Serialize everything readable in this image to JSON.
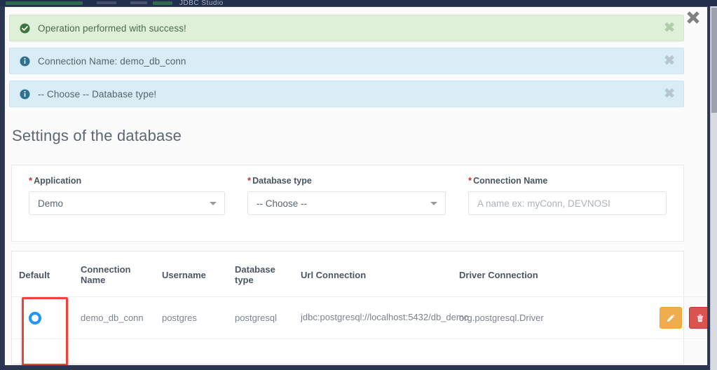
{
  "background_strip": {
    "title_fragment": "JDBC Studio"
  },
  "modal": {
    "close_label": "✖",
    "close_icon": "close-x-icon"
  },
  "alerts": [
    {
      "type": "success",
      "icon": "check-circle-icon",
      "message": "Operation performed with success!",
      "close_label": "✖"
    },
    {
      "type": "info",
      "icon": "info-circle-icon",
      "message": "Connection Name: demo_db_conn",
      "close_label": "✖"
    },
    {
      "type": "info",
      "icon": "info-circle-icon",
      "message": "-- Choose -- Database type!",
      "close_label": "✖"
    }
  ],
  "section": {
    "heading": "Settings of the database"
  },
  "form": {
    "required_marker": "*",
    "fields": {
      "application": {
        "label": "Application",
        "value": "Demo",
        "caret_icon": "chevron-down-icon"
      },
      "database_type": {
        "label": "Database type",
        "value": "-- Choose --",
        "caret_icon": "chevron-down-icon"
      },
      "connection_name": {
        "label": "Connection Name",
        "value": "",
        "placeholder": "A name ex: myConn, DEVNOSI"
      }
    }
  },
  "table": {
    "columns": [
      "Default",
      "Connection Name",
      "Username",
      "Database type",
      "Url Connection",
      "Driver Connection",
      ""
    ],
    "rows": [
      {
        "default_selected": true,
        "connection_name": "demo_db_conn",
        "username": "postgres",
        "database_type": "postgresql",
        "url_connection": "jdbc:postgresql://localhost:5432/db_demo",
        "driver_connection": "org.postgresql.Driver",
        "actions": {
          "edit_icon": "pencil-icon",
          "delete_icon": "trash-icon"
        }
      }
    ]
  },
  "annotation": {
    "highlight_color": "#e8453c",
    "highlight_target": "default-radio-column"
  },
  "colors": {
    "success_bg": "#dff0d8",
    "info_bg": "#d9edf7",
    "accent_blue": "#2196f3",
    "edit_orange": "#f0ad4e",
    "delete_red": "#d9534f",
    "required_red": "#c9302c"
  }
}
